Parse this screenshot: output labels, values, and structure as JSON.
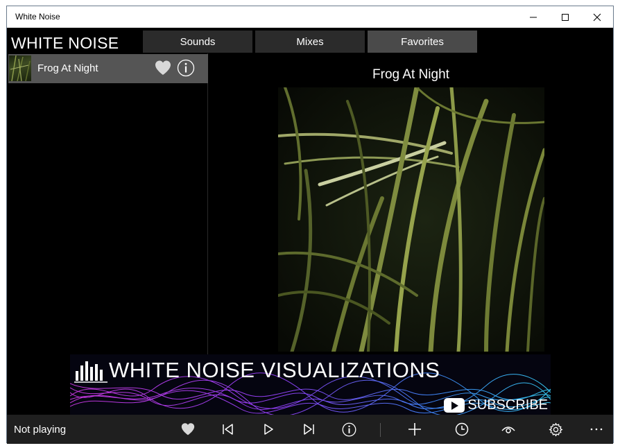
{
  "window": {
    "title": "White Noise"
  },
  "app": {
    "title": "WHITE NOISE"
  },
  "tabs": [
    {
      "label": "Sounds"
    },
    {
      "label": "Mixes"
    },
    {
      "label": "Favorites"
    }
  ],
  "list": {
    "items": [
      {
        "label": "Frog At Night"
      }
    ]
  },
  "detail": {
    "title": "Frog At Night"
  },
  "banner": {
    "headline": "WHITE NOISE VISUALIZATIONS",
    "subscribe": "SUBSCRIBE"
  },
  "player": {
    "status": "Not playing"
  },
  "colors": {
    "background": "#000000",
    "tab": "#2b2b2b",
    "tab_active": "#4a4a4a",
    "list_selected": "#555555",
    "bottom_bar": "#1f1f1f"
  },
  "icons": [
    "minimize-icon",
    "maximize-icon",
    "close-icon",
    "heart-icon",
    "info-icon",
    "skip-previous-icon",
    "play-icon",
    "skip-next-icon",
    "add-icon",
    "timer-icon",
    "eye-icon",
    "settings-icon",
    "more-icon"
  ]
}
